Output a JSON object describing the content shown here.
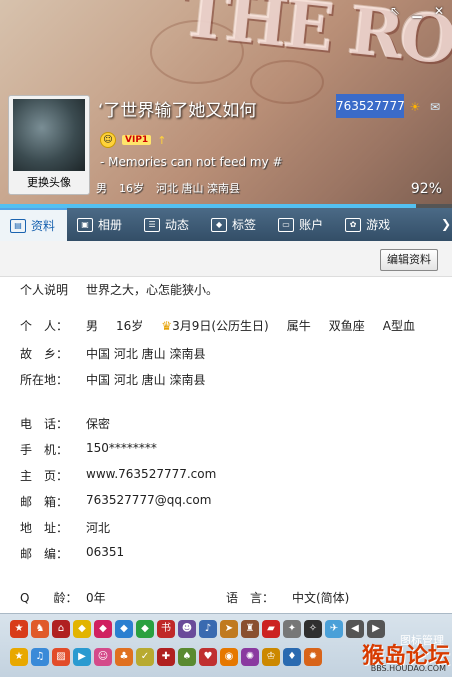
{
  "header": {
    "banner_text": "THE ROSE",
    "nickname": "‘了世界输了她又如何",
    "qq_number": "763527777",
    "vip_label": "VIP1",
    "signature": "- Memories can not feed my #",
    "gender": "男",
    "age": "16岁",
    "location": "河北 唐山 滦南县",
    "completion": "92%",
    "completion_value": 0.92,
    "avatar_button": "更换头像"
  },
  "tabs": [
    {
      "label": "资料",
      "icon": "profile-icon"
    },
    {
      "label": "相册",
      "icon": "album-icon"
    },
    {
      "label": "动态",
      "icon": "feed-icon"
    },
    {
      "label": "标签",
      "icon": "tag-icon"
    },
    {
      "label": "账户",
      "icon": "account-icon"
    },
    {
      "label": "游戏",
      "icon": "game-icon"
    }
  ],
  "toolbar": {
    "edit_label": "编辑资料"
  },
  "profile": {
    "intro_label": "个人说明",
    "intro_value": "世界之大，心怎能狭小。",
    "person_label": "个　人：",
    "person_gender": "男",
    "person_age": "16岁",
    "person_birthday": "3月9日(公历生日)",
    "person_zodiac": "属牛",
    "person_star": "双鱼座",
    "person_blood": "A型血",
    "hometown_label": "故　乡：",
    "hometown_value": "中国 河北 唐山 滦南县",
    "residence_label": "所在地：",
    "residence_value": "中国 河北 唐山 滦南县",
    "phone_label": "电　话：",
    "phone_value": "保密",
    "mobile_label": "手　机：",
    "mobile_value": "150********",
    "homepage_label": "主　页：",
    "homepage_value": "www.763527777.com",
    "email_label": "邮　箱：",
    "email_value": "763527777@qq.com",
    "address_label": "地　址：",
    "address_value": "河北",
    "zip_label": "邮　编：",
    "zip_value": "06351",
    "qage_label": "Q　　龄：",
    "qage_value": "0年",
    "lang_label": "语　言：",
    "lang_value": "中文(简体)"
  },
  "footer": {
    "manage_label": "图标管理",
    "watermark": "猴岛论坛",
    "watermark_url": "BBS.HOUDAO.COM"
  },
  "colors": {
    "accent": "#3a6bc9",
    "progress": "#53c0f1",
    "tab_bar": "#3d5a75"
  }
}
